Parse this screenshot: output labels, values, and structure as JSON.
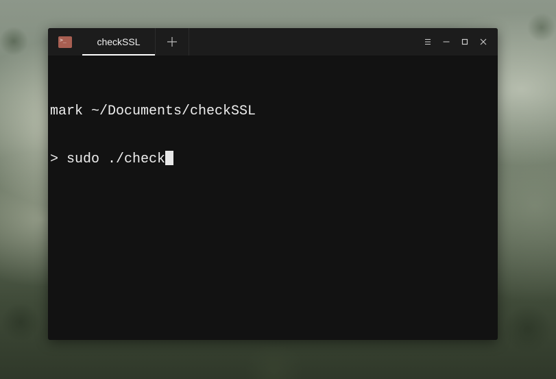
{
  "window": {
    "tab_title": "checkSSL",
    "app_icon_glyph": ">_",
    "new_tab_icon": "plus-icon",
    "controls": {
      "menu_icon": "hamburger-menu-icon",
      "minimize_icon": "minimize-icon",
      "maximize_icon": "maximize-icon",
      "close_icon": "close-icon"
    }
  },
  "terminal": {
    "prompt_header": "mark ~/Documents/checkSSL",
    "prompt_symbol": ">",
    "command": "sudo ./check"
  },
  "colors": {
    "app_icon_bg": "#a85f52",
    "terminal_bg": "#121212",
    "titlebar_bg": "#1c1c1c",
    "text": "#eeeeee"
  }
}
